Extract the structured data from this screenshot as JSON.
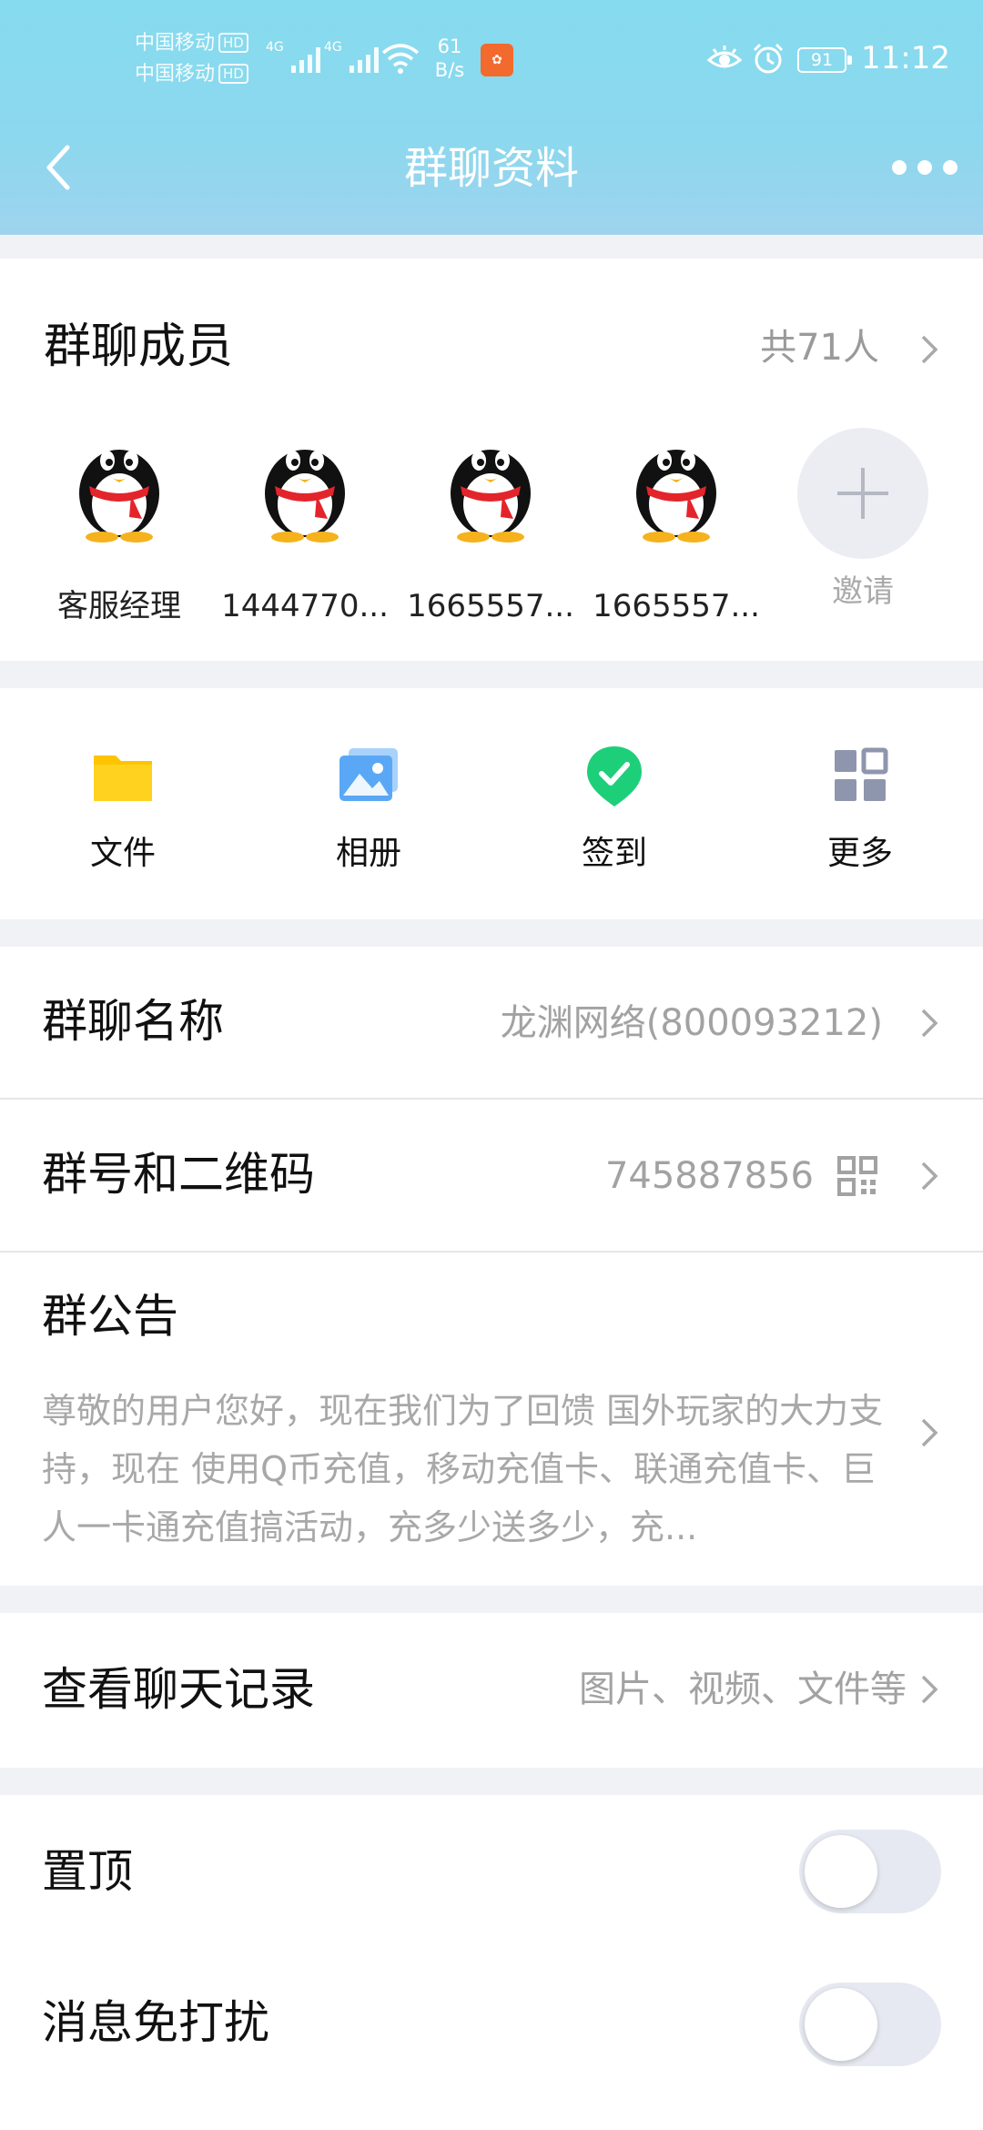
{
  "status_bar": {
    "carrier1": "中国移动",
    "carrier2": "中国移动",
    "hd": "HD",
    "net1": "4G",
    "net2": "4G",
    "speed_value": "61",
    "speed_unit": "B/s",
    "battery": "91",
    "time": "11:12"
  },
  "header": {
    "title": "群聊资料",
    "back_icon": "chevron-left-icon",
    "more_icon": "more-dots-icon"
  },
  "members": {
    "title": "群聊成员",
    "count": "共71人",
    "list": [
      {
        "name": "客服经理"
      },
      {
        "name": "1444770..."
      },
      {
        "name": "1665557..."
      },
      {
        "name": "1665557..."
      }
    ],
    "invite_label": "邀请"
  },
  "tools": [
    {
      "label": "文件",
      "icon": "folder-icon"
    },
    {
      "label": "相册",
      "icon": "album-icon"
    },
    {
      "label": "签到",
      "icon": "checkin-icon"
    },
    {
      "label": "更多",
      "icon": "grid-icon"
    }
  ],
  "group_name": {
    "label": "群聊名称",
    "value": "龙渊网络(800093212)"
  },
  "group_number": {
    "label": "群号和二维码",
    "value": "745887856",
    "icon": "qr-code-icon"
  },
  "notice": {
    "label": "群公告",
    "text": "尊敬的用户您好，现在我们为了回馈 国外玩家的大力支持，现在 使用Q币充值，移动充值卡、联通充值卡、巨人一卡通充值搞活动，充多少送多少，充..."
  },
  "chat_history": {
    "label": "查看聊天记录",
    "value": "图片、视频、文件等"
  },
  "pin": {
    "label": "置顶",
    "on": false
  },
  "dnd": {
    "label": "消息免打扰",
    "on": false
  },
  "colors": {
    "header_gradient_top": "#86dbee",
    "secondary_text": "#a2a2a2",
    "folder_yellow": "#ffc400",
    "album_blue": "#5aa8f5",
    "checkin_green": "#1ecf7a",
    "grid_gray": "#8e96ad"
  }
}
